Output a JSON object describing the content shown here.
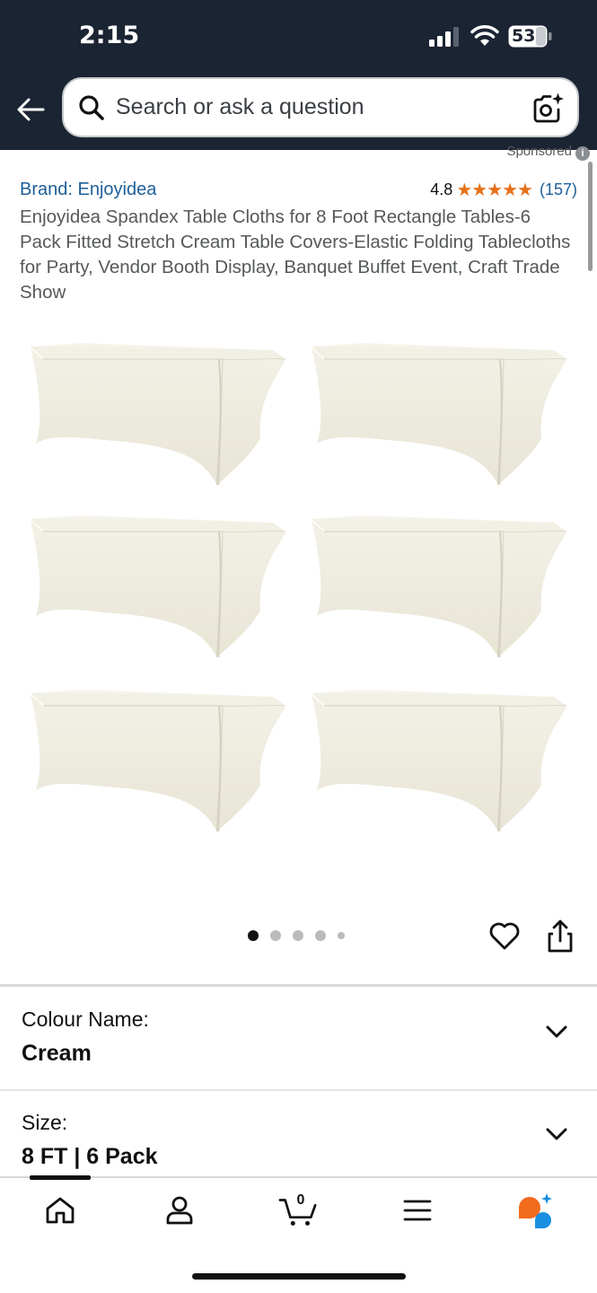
{
  "status_bar": {
    "time": "2:15",
    "battery": "53"
  },
  "search": {
    "placeholder": "Search or ask a question"
  },
  "sponsored": "Sponsored",
  "product": {
    "brand": "Brand: Enjoyidea",
    "rating": "4.8",
    "stars": "★★★★★",
    "review_count": "(157)",
    "title": "Enjoyidea Spandex Table Cloths for 8 Foot Rectangle Tables-6 Pack Fitted Stretch Cream Table Covers-Elastic Folding Tablecloths for Party, Vendor Booth Display, Banquet Buffet Event, Craft Trade Show",
    "image_count": 5,
    "active_image": 1
  },
  "options": [
    {
      "label": "Colour Name:",
      "value": "Cream"
    },
    {
      "label": "Size:",
      "value": "8 FT | 6 Pack"
    }
  ],
  "bottom_nav": {
    "items": [
      "home-icon",
      "account-icon",
      "cart-icon",
      "menu-icon",
      "rufus-icon"
    ],
    "cart_count": "0"
  },
  "colors": {
    "header_bg": "#1b2433",
    "link": "#1e5f99",
    "star": "#e7711b",
    "rufus_orange": "#f26b1d",
    "rufus_blue": "#1a8fe0"
  }
}
